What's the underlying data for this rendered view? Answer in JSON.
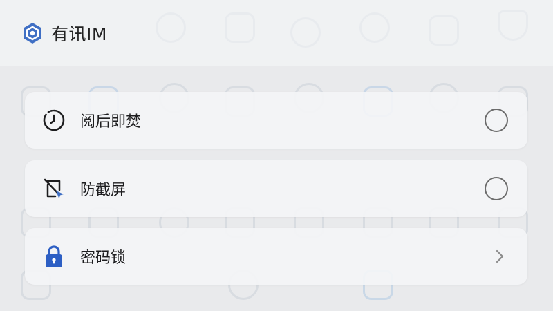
{
  "app": {
    "title": "有讯IM",
    "logo_icon": "hexagon-shield-logo",
    "accent_color": "#3f6fc4"
  },
  "options": [
    {
      "label": "阅后即焚",
      "icon": "timer-burn-icon",
      "control": "radio",
      "selected": false
    },
    {
      "label": "防截屏",
      "icon": "screenshot-block-icon",
      "control": "radio",
      "selected": false
    },
    {
      "label": "密码锁",
      "icon": "lock-icon",
      "control": "chevron",
      "icon_color": "#2d5fc4"
    }
  ]
}
